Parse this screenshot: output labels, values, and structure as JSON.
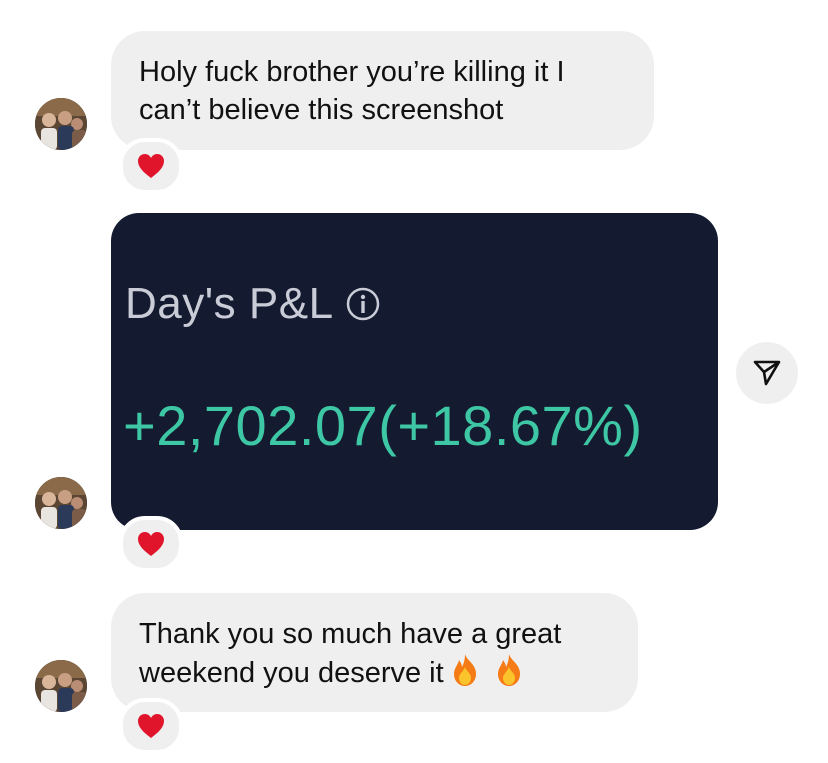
{
  "messages": [
    {
      "text": "Holy fuck brother you’re killing it I can’t believe this screenshot",
      "reaction": "red-heart"
    },
    {
      "image": {
        "title": "Day's P&L",
        "value": "+2,702.07(+18.67%)",
        "background": "#141b30",
        "title_color": "#c9ccd6",
        "value_color": "#3ec7a4"
      },
      "reaction": "red-heart"
    },
    {
      "text": "Thank you so much have a great weekend you deserve it",
      "trailing_emoji": [
        "fire",
        "fire"
      ],
      "reaction": "red-heart"
    }
  ],
  "share_icon": "paper-plane-icon",
  "colors": {
    "bubble": "#efefef",
    "heart": "#e0152b",
    "text": "#111111"
  }
}
